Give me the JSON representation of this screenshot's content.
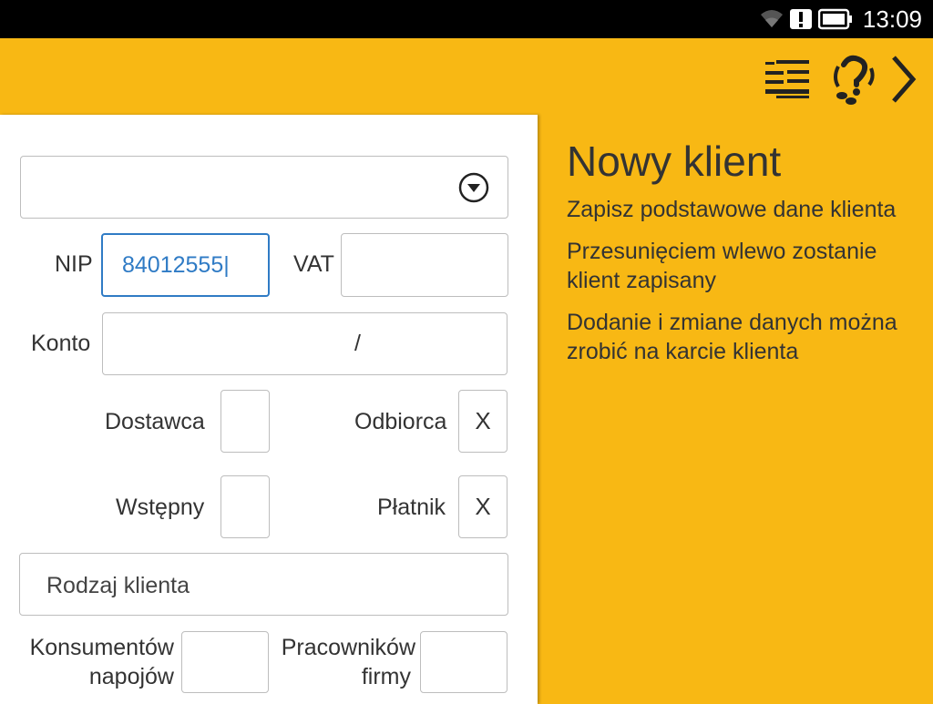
{
  "status_bar": {
    "time": "13:09",
    "icons": [
      "wifi-icon",
      "alert-icon",
      "battery-icon"
    ]
  },
  "toolbar": {
    "icons": [
      "list-icon",
      "help-icon",
      "next-chevron-icon"
    ]
  },
  "form": {
    "customer_select": {
      "value": ""
    },
    "nip": {
      "label": "NIP",
      "value": "84012555|"
    },
    "vat": {
      "label": "VAT",
      "value": ""
    },
    "konto": {
      "label": "Konto",
      "value": "/"
    },
    "dostawca": {
      "label": "Dostawca",
      "value": ""
    },
    "odbiorca": {
      "label": "Odbiorca",
      "value": "X"
    },
    "wstepny": {
      "label": "Wstępny",
      "value": ""
    },
    "platnik": {
      "label": "Płatnik",
      "value": "X"
    },
    "rodzaj_klienta": {
      "placeholder": "Rodzaj klienta"
    },
    "konsumentow": {
      "label_line1": "Konsumentów",
      "label_line2": "napojów",
      "value": ""
    },
    "pracownikow": {
      "label_line1": "Pracowników",
      "label_line2": "firmy",
      "value": ""
    }
  },
  "info": {
    "title": "Nowy klient",
    "paragraphs": [
      "Zapisz podstawowe dane klienta",
      "Przesunięciem wlewo zostanie klient zapisany",
      "Dodanie i zmiane danych można zrobić na karcie klienta"
    ]
  },
  "colors": {
    "accent": "#F8B814",
    "input_focus": "#2F7BC5",
    "status_bar": "#000000"
  }
}
